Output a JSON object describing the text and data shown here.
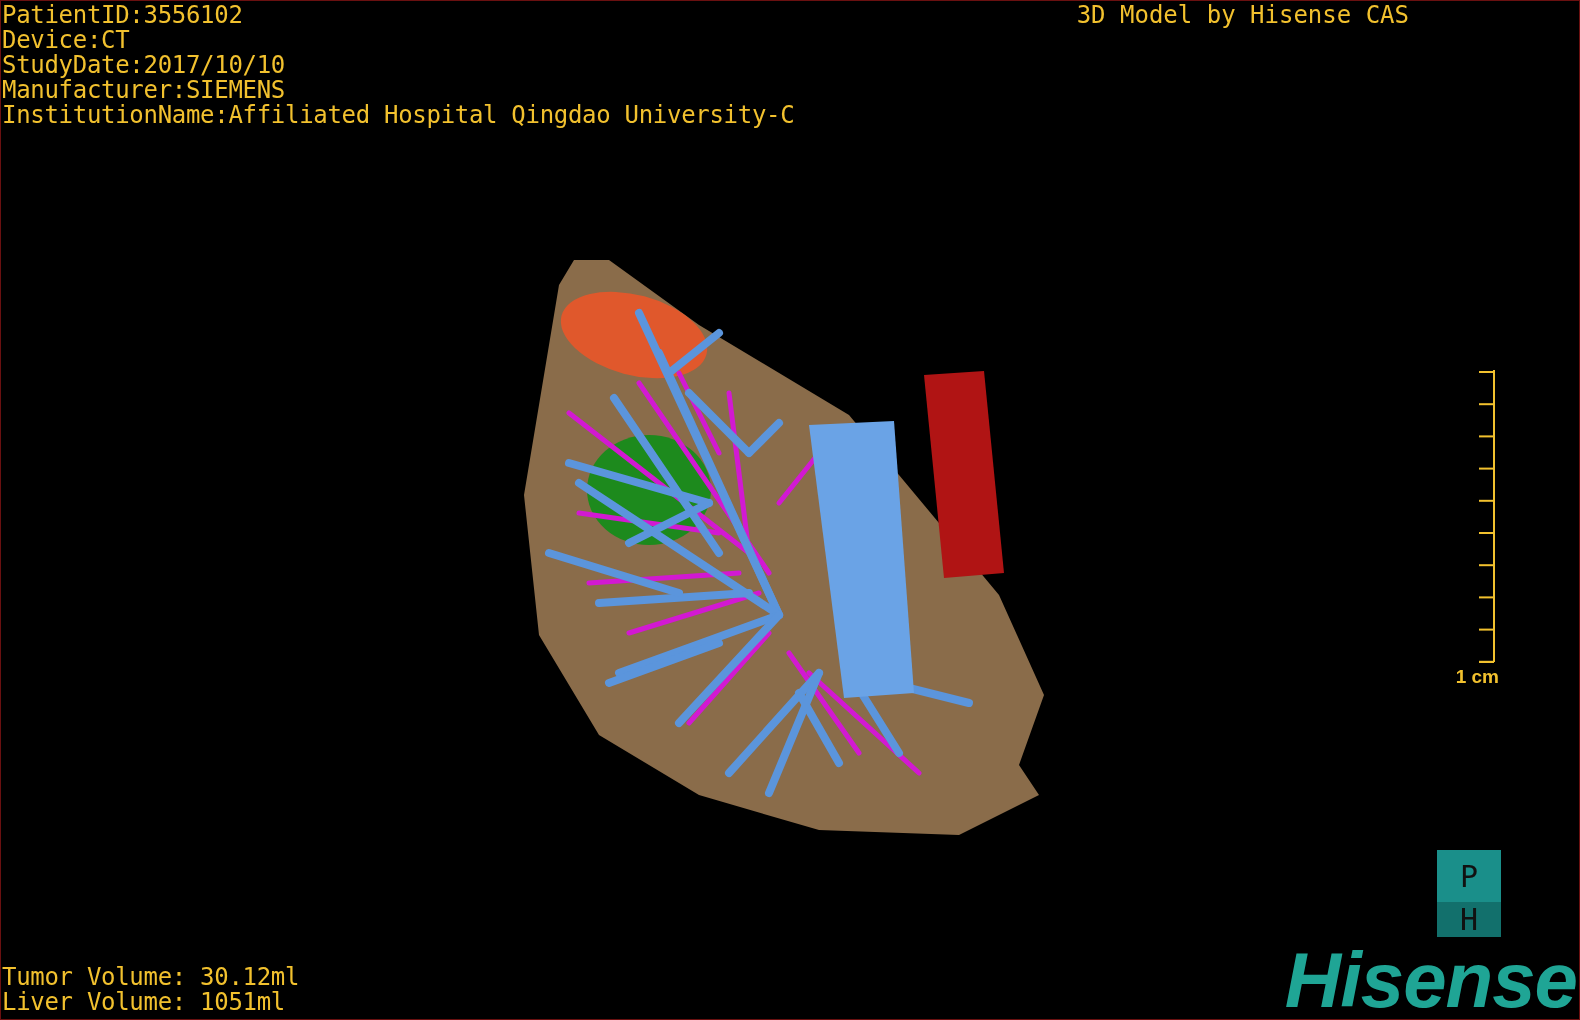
{
  "header_lines": [
    "PatientID:3556102",
    "Device:CT",
    "StudyDate:2017/10/10",
    "Manufacturer:SIEMENS",
    "InstitutionName:Affiliated Hospital Qingdao University-C"
  ],
  "title": "3D Model by Hisense CAS",
  "scale_bar": {
    "label": "1 cm"
  },
  "volumes": [
    "Tumor Volume: 30.12ml",
    "Liver Volume: 1051ml"
  ],
  "orientation_cube": {
    "top": "P",
    "bottom": "H"
  },
  "logo": "Hisense"
}
